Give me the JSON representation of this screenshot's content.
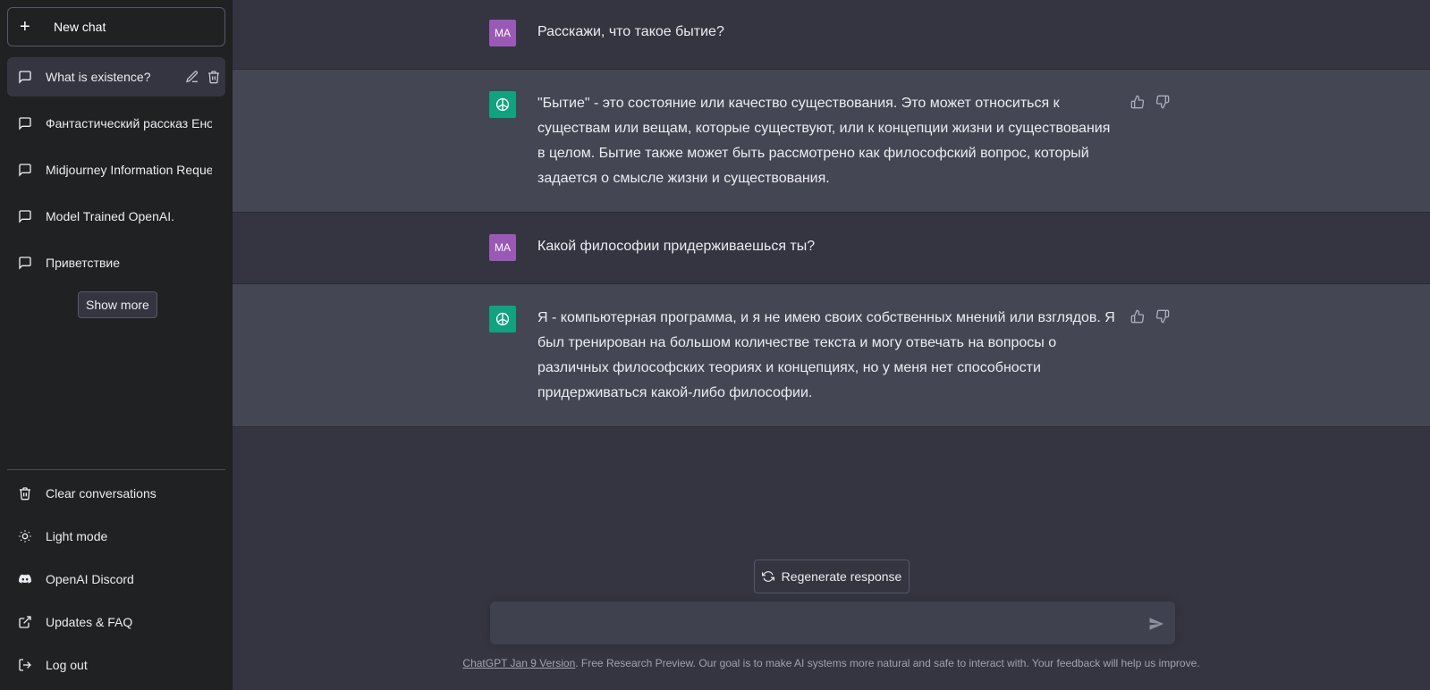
{
  "sidebar": {
    "new_chat": "New chat",
    "conversations": [
      {
        "label": "What is existence?",
        "active": true
      },
      {
        "label": "Фантастический рассказ Енот"
      },
      {
        "label": "Midjourney Information Reque"
      },
      {
        "label": "Model Trained OpenAI."
      },
      {
        "label": "Приветствие"
      }
    ],
    "show_more": "Show more",
    "menu": [
      {
        "label": "Clear conversations",
        "icon": "trash-icon"
      },
      {
        "label": "Light mode",
        "icon": "sun-icon"
      },
      {
        "label": "OpenAI Discord",
        "icon": "discord-icon"
      },
      {
        "label": "Updates & FAQ",
        "icon": "external-link-icon"
      },
      {
        "label": "Log out",
        "icon": "logout-icon"
      }
    ]
  },
  "chat": {
    "messages": [
      {
        "role": "user",
        "avatar": "MA",
        "text": "Расскажи, что такое бытие?"
      },
      {
        "role": "assistant",
        "text": "\"Бытие\" - это состояние или качество существования. Это может относиться к существам или вещам, которые существуют, или к концепции жизни и существования в целом. Бытие также может быть рассмотрено как философский вопрос, который задается о смысле жизни и существования."
      },
      {
        "role": "user",
        "avatar": "MA",
        "text": "Какой философии придерживаешься ты?"
      },
      {
        "role": "assistant",
        "text": "Я - компьютерная программа, и я не имею своих собственных мнений или взглядов. Я был тренирован на большом количестве текста и могу отвечать на вопросы о различных философских теориях и концепциях, но у меня нет способности придерживаться какой-либо философии."
      }
    ]
  },
  "composer": {
    "regenerate": "Regenerate response",
    "input_value": ""
  },
  "footer": {
    "link": "ChatGPT Jan 9 Version",
    "text": ". Free Research Preview. Our goal is to make AI systems more natural and safe to interact with. Your feedback will help us improve."
  },
  "colors": {
    "sidebar_bg": "#202123",
    "main_bg": "#343541",
    "assistant_row_bg": "#444654",
    "user_avatar": "#9b59b6",
    "assistant_avatar": "#10a37f"
  }
}
